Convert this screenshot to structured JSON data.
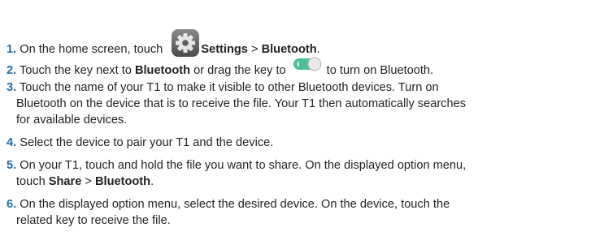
{
  "steps": [
    {
      "num": "1.",
      "pre": "On the home screen, touch",
      "icon": "settings-gear-icon",
      "b1": "Settings",
      "sep": " > ",
      "b2": "Bluetooth",
      "post": "."
    },
    {
      "num": "2.",
      "pre": "Touch the key next to ",
      "b1": "Bluetooth",
      "mid": " or drag the key to",
      "icon": "toggle-switch-on-icon",
      "post": "to turn on Bluetooth."
    },
    {
      "num": "3.",
      "line1": "Touch the name of your T1 to make it visible to other Bluetooth devices. Turn on",
      "line2": "Bluetooth on the device that is to receive the file. Your T1 then automatically searches",
      "line3": "for available devices."
    },
    {
      "num": "4.",
      "line1": "Select the device to pair your T1 and the device."
    },
    {
      "num": "5.",
      "line1": "On your T1, touch and hold the file you want to share. On the displayed option menu,",
      "line2_pre": "touch ",
      "b1": "Share",
      "sep": " > ",
      "b2": "Bluetooth",
      "post": "."
    },
    {
      "num": "6.",
      "line1": "On the displayed option menu, select the desired device. On the device, touch the",
      "line2": "related key to receive the file."
    }
  ],
  "colors": {
    "step_number": "#1f6fa8",
    "text": "#231f20",
    "toggle_on": "#4bbf9a"
  }
}
